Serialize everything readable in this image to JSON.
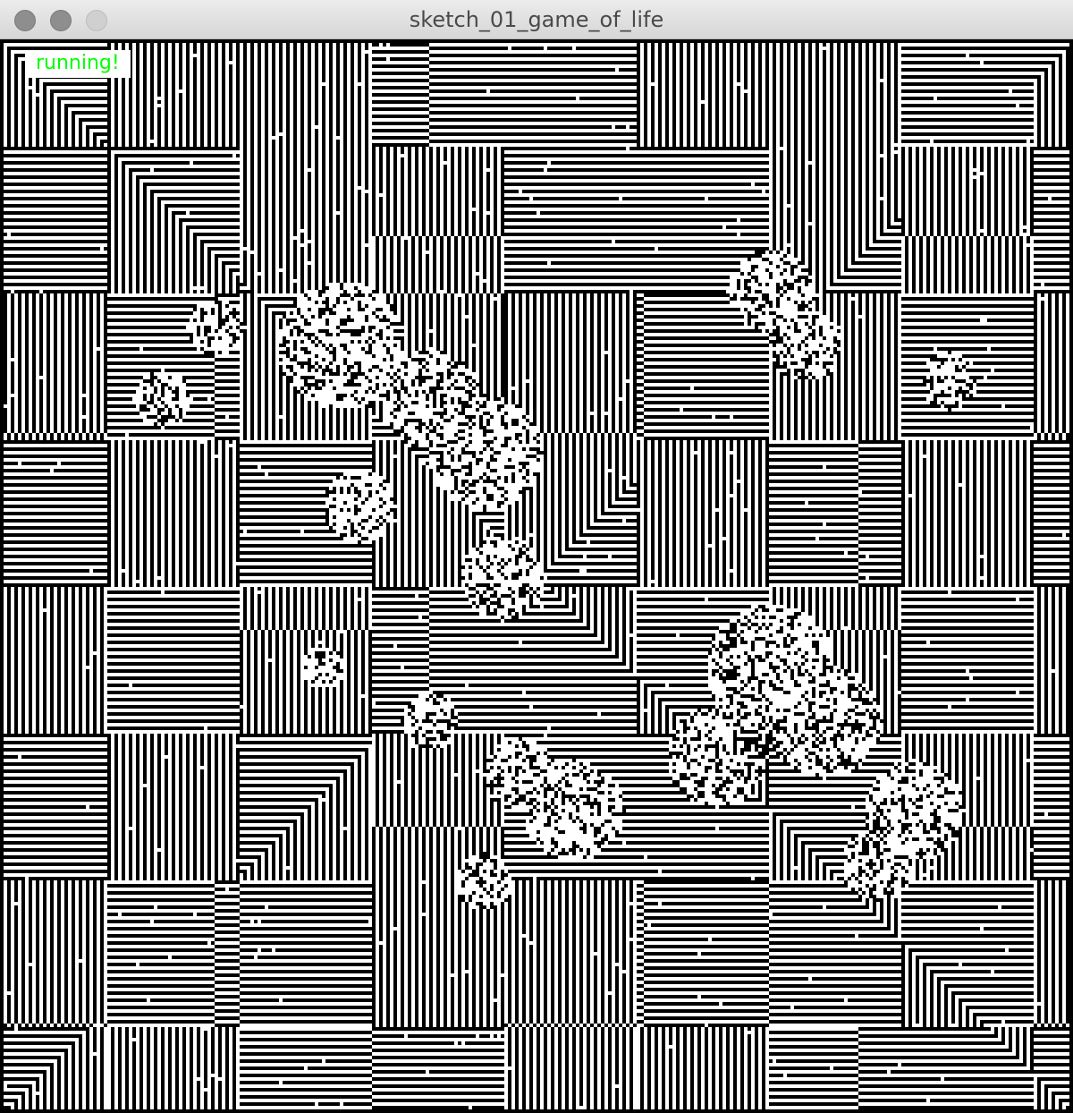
{
  "window": {
    "title": "sketch_01_game_of_life"
  },
  "canvas": {
    "status_text": "running!",
    "status_color": "#00ff00",
    "alive_color": "#000000",
    "dead_color": "#ffffff",
    "pattern": "maze-like Game of Life grid with chaotic regions"
  }
}
